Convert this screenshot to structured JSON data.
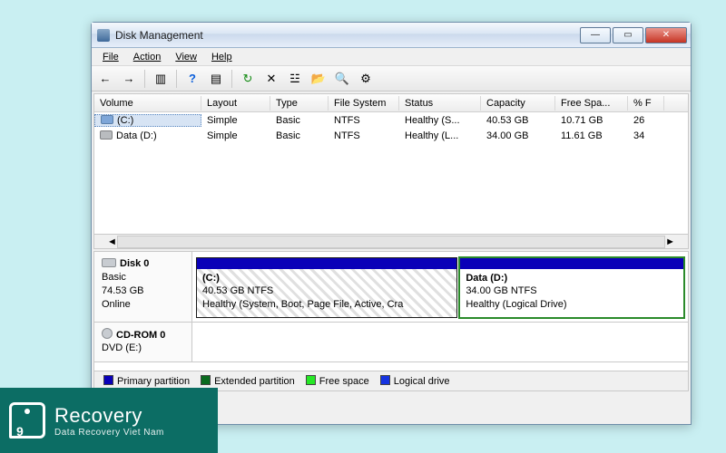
{
  "window": {
    "title": "Disk Management"
  },
  "menubar": {
    "file": "File",
    "action": "Action",
    "view": "View",
    "help": "Help"
  },
  "toolbar_icons": {
    "back": "←",
    "forward": "→",
    "showhide": "▥",
    "help": "?",
    "props": "▤",
    "refresh": "↻",
    "delete": "✕",
    "settings": "☳",
    "open": "📂",
    "find": "🔍",
    "actions": "⚙"
  },
  "columns": {
    "volume": "Volume",
    "layout": "Layout",
    "type": "Type",
    "fs": "File System",
    "status": "Status",
    "capacity": "Capacity",
    "free": "Free Spa...",
    "pct": "% F"
  },
  "volumes": [
    {
      "name": "(C:)",
      "layout": "Simple",
      "type": "Basic",
      "fs": "NTFS",
      "status": "Healthy (S...",
      "capacity": "40.53 GB",
      "free": "10.71 GB",
      "pct": "26"
    },
    {
      "name": "Data (D:)",
      "layout": "Simple",
      "type": "Basic",
      "fs": "NTFS",
      "status": "Healthy (L...",
      "capacity": "34.00 GB",
      "free": "11.61 GB",
      "pct": "34"
    }
  ],
  "disks": [
    {
      "title": "Disk 0",
      "type": "Basic",
      "size": "74.53 GB",
      "state": "Online",
      "partitions": [
        {
          "label": "(C:)",
          "size": "40.53 GB NTFS",
          "status": "Healthy (System, Boot, Page File, Active, Cra",
          "hatched": true,
          "selected": false
        },
        {
          "label": "Data  (D:)",
          "size": "34.00 GB NTFS",
          "status": "Healthy (Logical Drive)",
          "hatched": false,
          "selected": true
        }
      ]
    },
    {
      "title": "CD-ROM 0",
      "type": "DVD (E:)",
      "size": "",
      "state": ""
    }
  ],
  "legend": {
    "primary": "Primary partition",
    "extended": "Extended partition",
    "free": "Free space",
    "logical": "Logical drive"
  },
  "brand": {
    "name": "Recovery",
    "tagline": "Data Recovery Viet Nam"
  }
}
